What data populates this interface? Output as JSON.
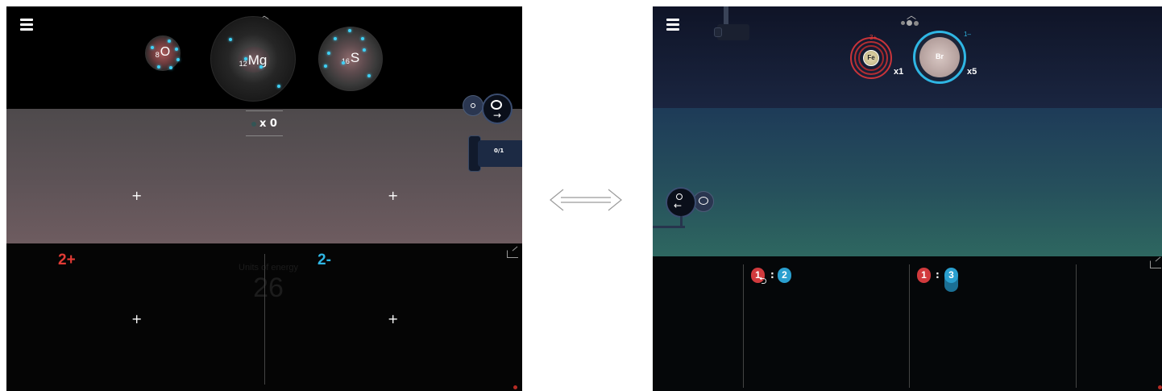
{
  "left_panel": {
    "atoms": [
      {
        "symbol": "O",
        "number": "8"
      },
      {
        "symbol": "Mg",
        "number": "12"
      },
      {
        "symbol": "S",
        "number": "16"
      }
    ],
    "counter": "x 0",
    "gun_counter": "0/1",
    "charges": {
      "cation": "2+",
      "anion": "2-"
    },
    "faint_label": "Units of energy",
    "faint_value": "26",
    "colors": {
      "cation": "#e23b35",
      "anion": "#2fb6e4"
    }
  },
  "right_panel": {
    "atoms": [
      {
        "symbol": "Fe",
        "charge": "3+",
        "multiplier": "x1"
      },
      {
        "symbol": "Br",
        "charge": "1–",
        "multiplier": "x5"
      }
    ],
    "ratios": [
      {
        "left": "1",
        "right": "2"
      },
      {
        "left": "1",
        "right": "3"
      }
    ],
    "colors": {
      "cation": "#e23b35",
      "anion": "#2fb6e4"
    }
  },
  "icons": {
    "menu": "hamburger-menu-icon",
    "swap": "double-headed-arrow-icon",
    "minimize": "minimize-icon"
  }
}
